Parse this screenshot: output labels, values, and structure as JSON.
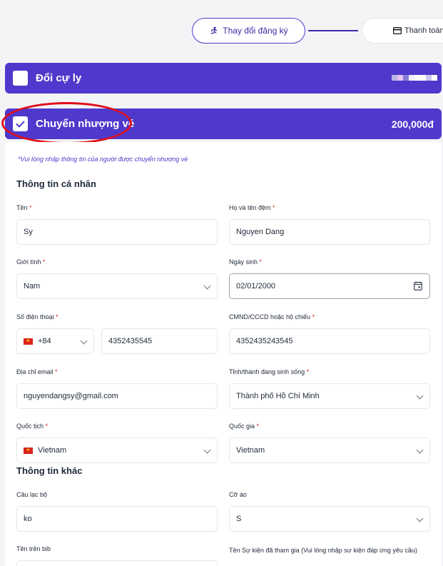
{
  "stepper": {
    "step1_label": "Thay đổi đăng ký",
    "step2_label": "Thanh toán"
  },
  "options": {
    "distance_label": "Đổi cự ly",
    "transfer_label": "Chuyển nhượng vé",
    "transfer_price": "200,000đ"
  },
  "form": {
    "note": "*Vui lòng nhập thông tin của người được chuyển nhượng vé",
    "personal_title": "Thông tin cá nhân",
    "first_name_label": "Tên",
    "first_name_value": "Sy",
    "last_name_label": "Họ và tên đệm",
    "last_name_value": "Nguyen Dang",
    "gender_label": "Giới tính",
    "gender_value": "Nam",
    "dob_label": "Ngày sinh",
    "dob_value": "02/01/2000",
    "phone_label": "Số điện thoại",
    "phone_code": "+84",
    "phone_value": "4352435545",
    "id_label": "CMND/CCCD hoặc hộ chiếu",
    "id_value": "4352435243545",
    "email_label": "Địa chỉ email",
    "email_value": "nguyendangsy@gmail.com",
    "city_label": "Tỉnh/thành đang sinh sống",
    "city_value": "Thành phố Hồ Chí Minh",
    "nationality_label": "Quốc tịch",
    "nationality_value": "Vietnam",
    "country_label": "Quốc gia",
    "country_value": "Vietnam",
    "other_title": "Thông tin khác",
    "club_label": "Câu lạc bộ",
    "club_value": "ko",
    "shirt_label": "Cỡ áo",
    "shirt_value": "S",
    "bib_label": "Tên trên bib",
    "events_label": "Tên Sự kiện đã tham gia (Vui lòng nhập sự kiện đáp ứng yêu cầu)",
    "required_mark": "*"
  },
  "colors": {
    "accent": "#4f39cc",
    "highlight": "#e10d1b"
  }
}
